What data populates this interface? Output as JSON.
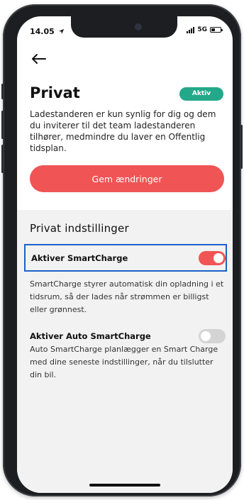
{
  "status": {
    "time": "14.05",
    "network": "5G"
  },
  "header": {
    "title": "Privat",
    "badge": "Aktiv",
    "description": "Ladestanderen er kun synlig for dig og dem du inviterer til det team ladestanderen tilhører, medmindre du laver en Offentlig tidsplan.",
    "save_label": "Gem ændringer"
  },
  "settings": {
    "title": "Privat indstillinger",
    "smartcharge": {
      "label": "Aktiver SmartCharge",
      "enabled": true,
      "description": "SmartCharge styrer automatisk din opladning i et tidsrum, så der lades når strømmen er billigst eller grønnest."
    },
    "auto_smartcharge": {
      "label": "Aktiver Auto SmartCharge",
      "enabled": false,
      "description": "Auto SmartCharge planlægger en Smart Charge med dine seneste indstillinger, når du tilslutter din bil."
    }
  },
  "colors": {
    "accent": "#f05454",
    "badge": "#23a88a",
    "highlight": "#1d61c8"
  }
}
